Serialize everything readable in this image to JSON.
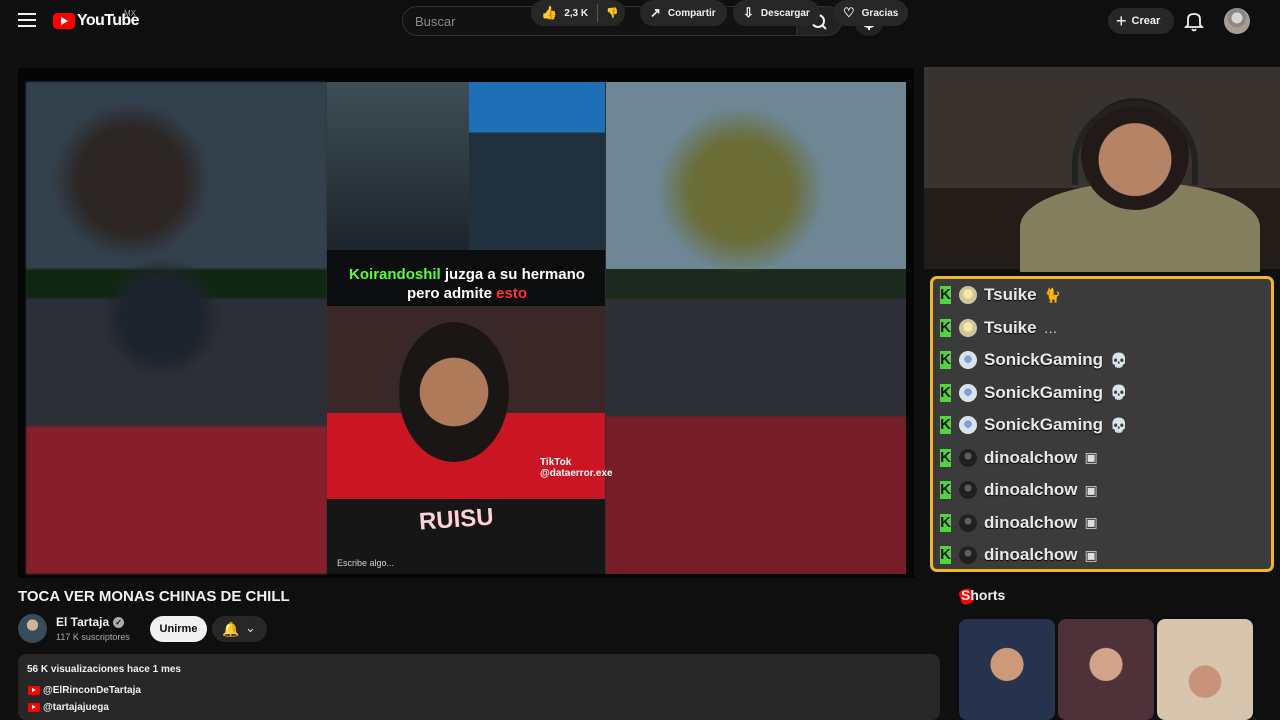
{
  "header": {
    "logo_text": "YouTube",
    "region": "MX",
    "search_placeholder": "Buscar",
    "create_label": "Crear"
  },
  "video_overlay": {
    "caption_name": "Koirandoshil",
    "caption_middle": " juzga a su ",
    "caption_word": "hermano",
    "caption_line2": "pero admite ",
    "caption_red": "esto",
    "tiktok_label": "TikTok",
    "tiktok_handle": "@dataerror.exe",
    "logo_word": "RUISU",
    "comment_placeholder": "Escribe algo..."
  },
  "chat": [
    {
      "user": "Tsuike",
      "avatar": "av-tsuike",
      "emote": "🐈"
    },
    {
      "user": "Tsuike",
      "avatar": "av-tsuike",
      "emote": "…"
    },
    {
      "user": "SonickGaming",
      "avatar": "av-sonick",
      "emote": "💀"
    },
    {
      "user": "SonickGaming",
      "avatar": "av-sonick",
      "emote": "💀"
    },
    {
      "user": "SonickGaming",
      "avatar": "av-sonick",
      "emote": "💀"
    },
    {
      "user": "dinoalchow",
      "avatar": "av-dino",
      "emote": "▣"
    },
    {
      "user": "dinoalchow",
      "avatar": "av-dino",
      "emote": "▣"
    },
    {
      "user": "dinoalchow",
      "avatar": "av-dino",
      "emote": "▣"
    },
    {
      "user": "dinoalchow",
      "avatar": "av-dino",
      "emote": "▣"
    }
  ],
  "video_info": {
    "title": "TOCA VER MONAS CHINAS DE CHILL",
    "channel": "El Tartaja",
    "subscribers": "117 K suscriptores",
    "join_label": "Unirme",
    "likes": "2,3 K",
    "share_label": "Compartir",
    "download_label": "Descargar",
    "thanks_label": "Gracias",
    "views_line": "56 K visualizaciones  hace 1 mes",
    "links": [
      "@ElRinconDeTartaja",
      "@tartajajuega"
    ]
  },
  "shorts": {
    "title": "Shorts"
  }
}
